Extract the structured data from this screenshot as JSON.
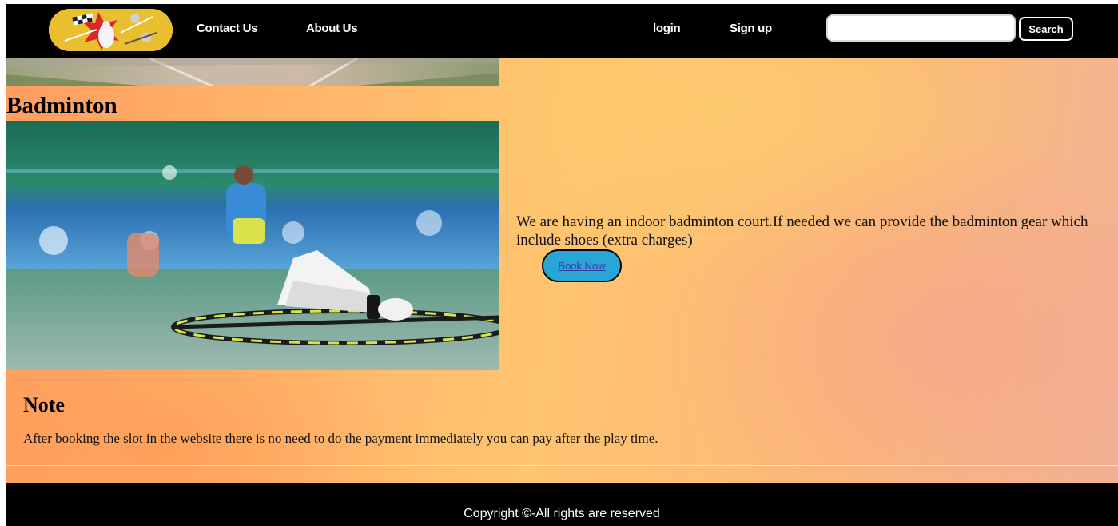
{
  "nav": {
    "contact_label": "Contact Us",
    "about_label": "About Us",
    "login_label": "login",
    "signup_label": "Sign up",
    "search_value": "",
    "search_placeholder": "",
    "search_button_label": "Search"
  },
  "main": {
    "title": "Badminton",
    "description": "We are having an indoor badminton court.If needed we can provide the badminton gear which include shoes (extra charges)",
    "book_button_label": "Book Now"
  },
  "note": {
    "title": "Note",
    "text": "After booking the slot in the website there is no need to do the payment immediately you can pay after the play time."
  },
  "footer": {
    "copyright": "Copyright ©-All rights are reserved"
  },
  "colors": {
    "nav_background": "#000000",
    "logo_background": "#e9bf2f",
    "book_button_background": "#2aa6d6",
    "footer_background": "#000000"
  }
}
